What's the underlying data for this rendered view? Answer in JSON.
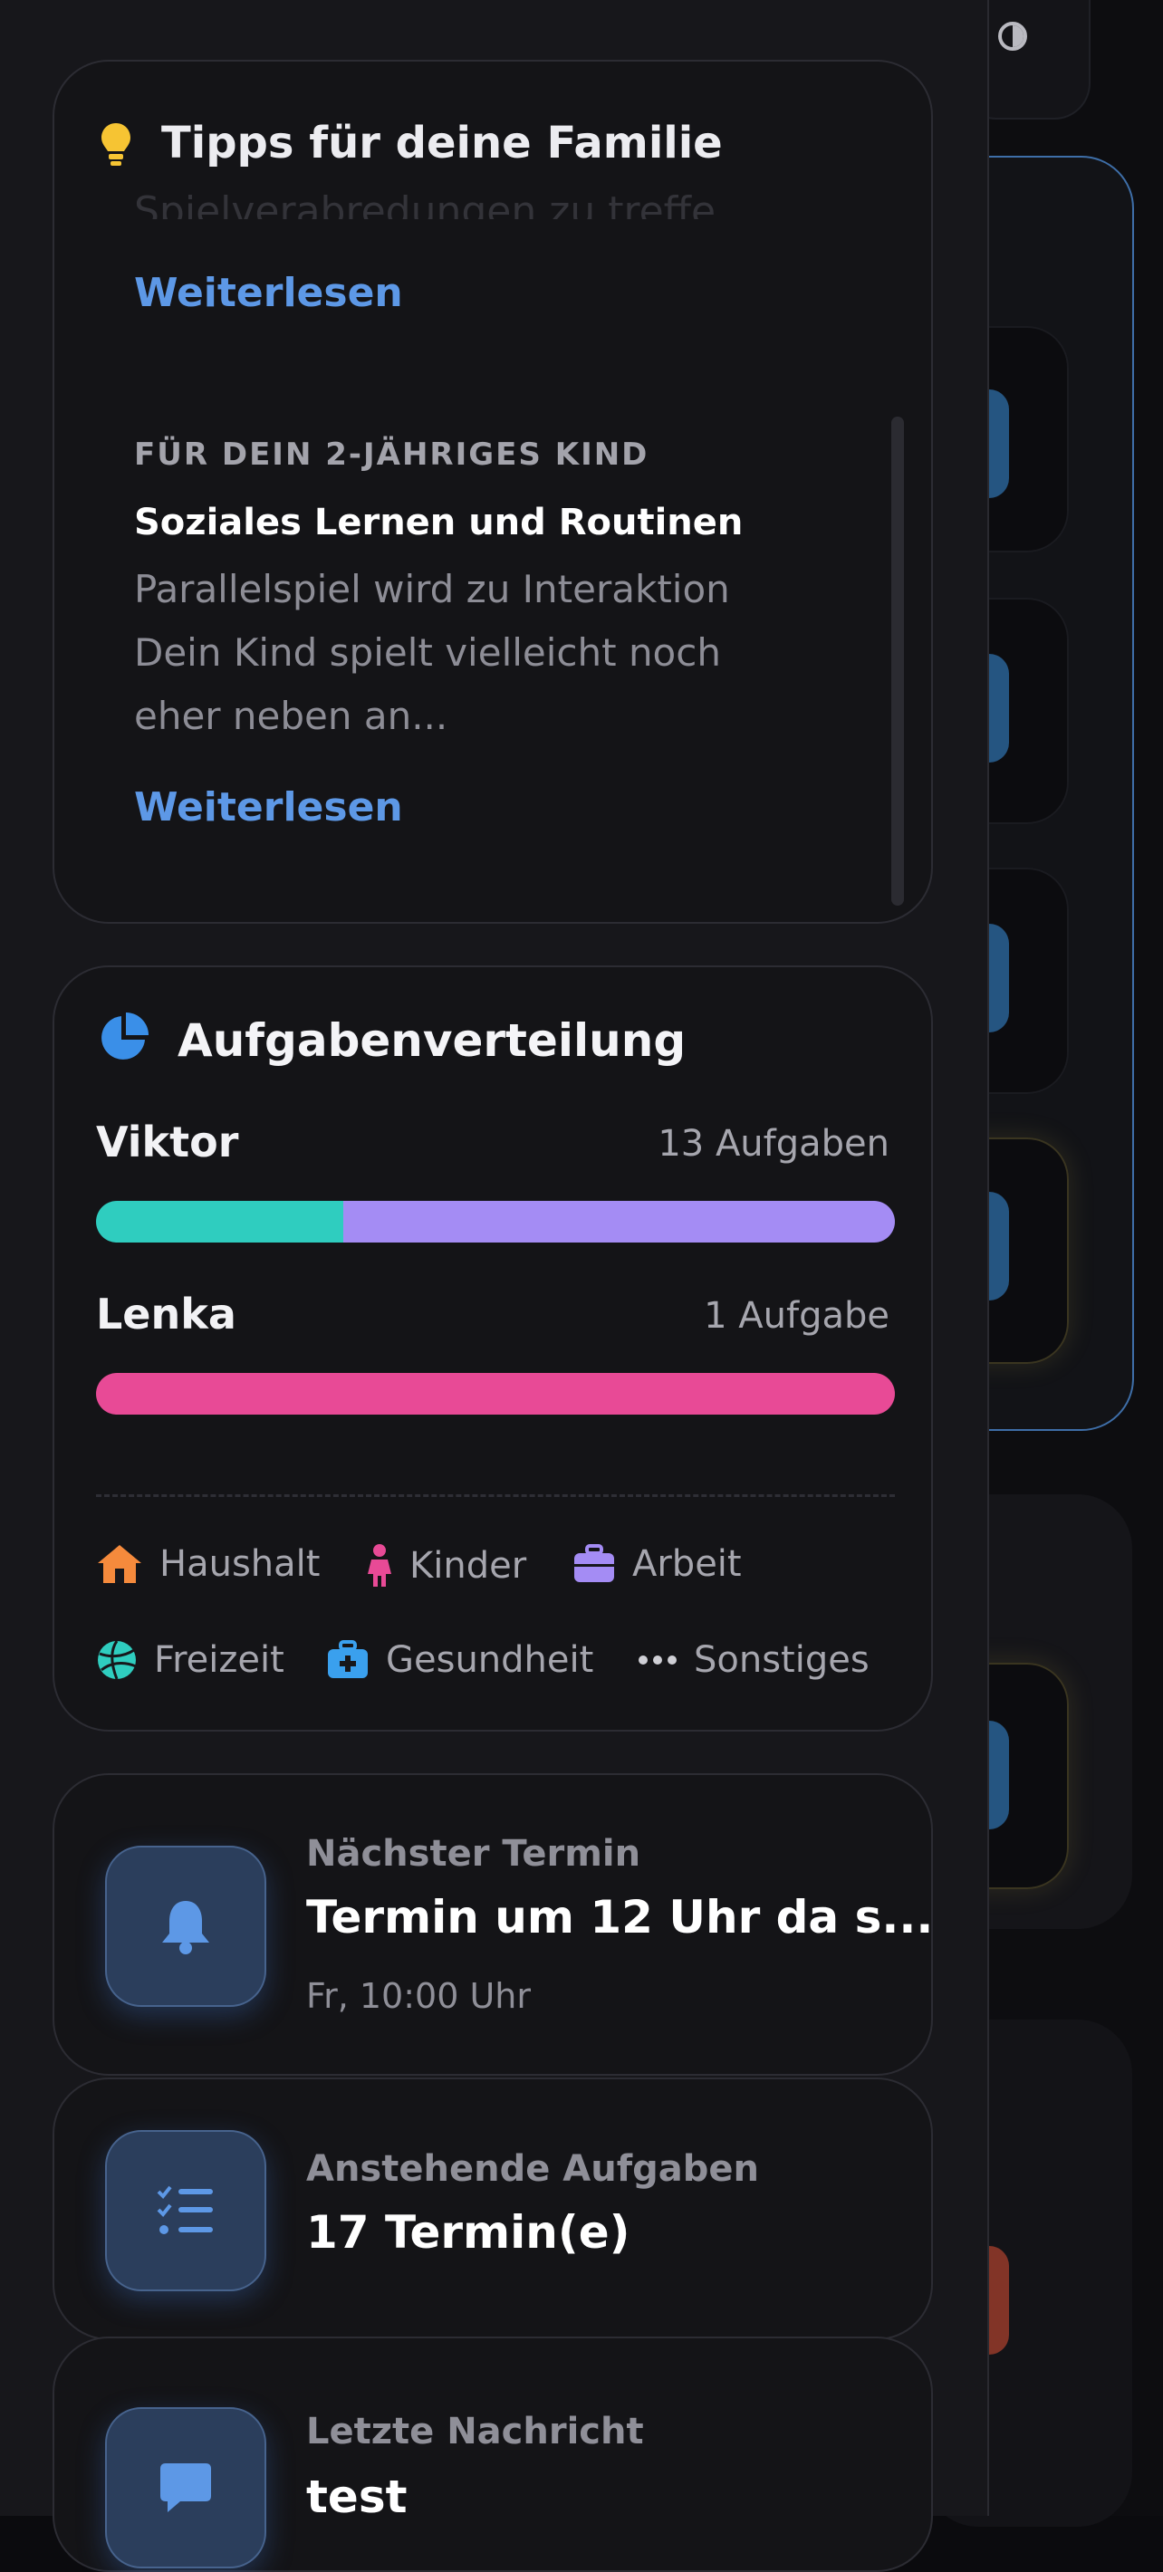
{
  "colors": {
    "accent_blue": "#5d98e6",
    "viktor_bar_haushalt": "#2fcdbf",
    "viktor_bar_arbeit": "#a48cf4",
    "lenka_bar_kinder": "#e84a96",
    "legend_haushalt": "#f58a3c",
    "legend_kinder": "#e84a96",
    "legend_arbeit": "#a48cf4",
    "legend_freizeit": "#2fcdbf",
    "legend_gesundheit": "#3aa0ee",
    "legend_sonstiges": "#cfcfd5"
  },
  "tips": {
    "title": "Tipps für deine Familie",
    "icon": "lightbulb-icon",
    "faded_text": "Spielverabredungen zu treffe...",
    "read_more_1": "Weiterlesen",
    "item": {
      "kicker": "FÜR DEIN 2-JÄHRIGES KIND",
      "title": "Soziales Lernen und Routinen",
      "body_line1": "Parallelspiel wird zu Interaktion",
      "body_line2": "Dein Kind spielt vielleicht noch",
      "body_line3": "eher neben an...",
      "read_more": "Weiterlesen"
    }
  },
  "distribution": {
    "title": "Aufgabenverteilung",
    "icon": "pie-chart-icon",
    "people": [
      {
        "name": "Viktor",
        "count": "13 Aufgaben",
        "segments": [
          {
            "category": "Haushalt",
            "share": 0.31
          },
          {
            "category": "Arbeit",
            "share": 0.69
          }
        ]
      },
      {
        "name": "Lenka",
        "count": "1 Aufgabe",
        "segments": [
          {
            "category": "Kinder",
            "share": 1.0
          }
        ]
      }
    ],
    "legend": [
      {
        "label": "Haushalt",
        "icon": "house-icon"
      },
      {
        "label": "Kinder",
        "icon": "child-icon"
      },
      {
        "label": "Arbeit",
        "icon": "briefcase-icon"
      },
      {
        "label": "Freizeit",
        "icon": "volleyball-icon"
      },
      {
        "label": "Gesundheit",
        "icon": "first-aid-kit-icon"
      },
      {
        "label": "Sonstiges",
        "icon": "more-dots-icon"
      }
    ]
  },
  "next_appointment": {
    "label": "Nächster Termin",
    "value": "Termin um 12 Uhr da s...",
    "sub": "Fr, 10:00 Uhr",
    "icon": "bell-icon"
  },
  "pending_tasks": {
    "label": "Anstehende Aufgaben",
    "value": "17 Termin(e)",
    "icon": "checklist-icon"
  },
  "last_message": {
    "label": "Letzte Nachricht",
    "value": "test",
    "icon": "chat-bubble-icon"
  }
}
